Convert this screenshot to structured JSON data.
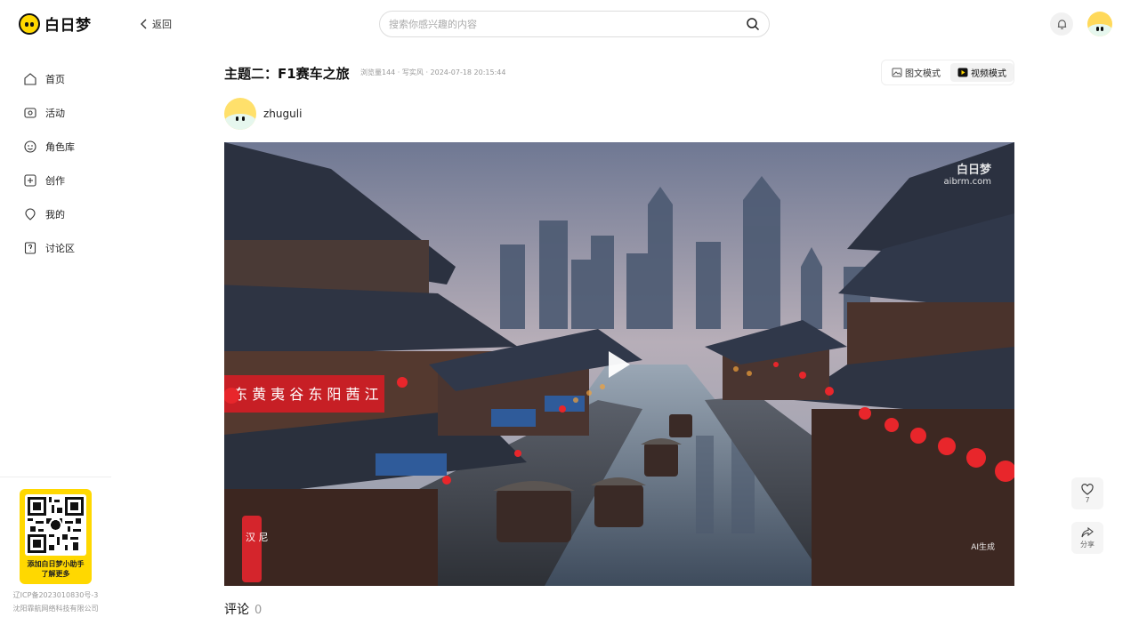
{
  "header": {
    "logo_text": "白日梦",
    "back_label": "返回",
    "search_placeholder": "搜索你感兴趣的内容"
  },
  "sidebar": {
    "items": [
      {
        "label": "首页",
        "icon": "home-icon"
      },
      {
        "label": "活动",
        "icon": "activity-icon"
      },
      {
        "label": "角色库",
        "icon": "character-icon"
      },
      {
        "label": "创作",
        "icon": "create-icon"
      },
      {
        "label": "我的",
        "icon": "profile-icon"
      },
      {
        "label": "讨论区",
        "icon": "discussion-icon"
      }
    ],
    "qr_line1": "添加白日梦小助手",
    "qr_line2": "了解更多",
    "icp": "辽ICP备2023010830号-3",
    "company": "沈阳霏航网络科技有限公司"
  },
  "post": {
    "title": "主题二：F1赛车之旅",
    "meta": "浏览量144 · 写实风 · 2024-07-18 20:15:44",
    "author": "zhuguli",
    "mode_image_text": "图文模式",
    "mode_video": "视频模式",
    "watermark_brand": "白日梦",
    "watermark_url": "aibrm.com",
    "ai_label": "AI生成",
    "lantern_text": "东 黄 夷 谷 东 阳 茜 江",
    "shop_sign": "汉 尼"
  },
  "comments": {
    "label": "评论",
    "count": "0"
  },
  "actions": {
    "like_count": "7",
    "share_label": "分享"
  },
  "colors": {
    "brand_yellow": "#FFD800",
    "lantern_red": "#E8262B"
  }
}
